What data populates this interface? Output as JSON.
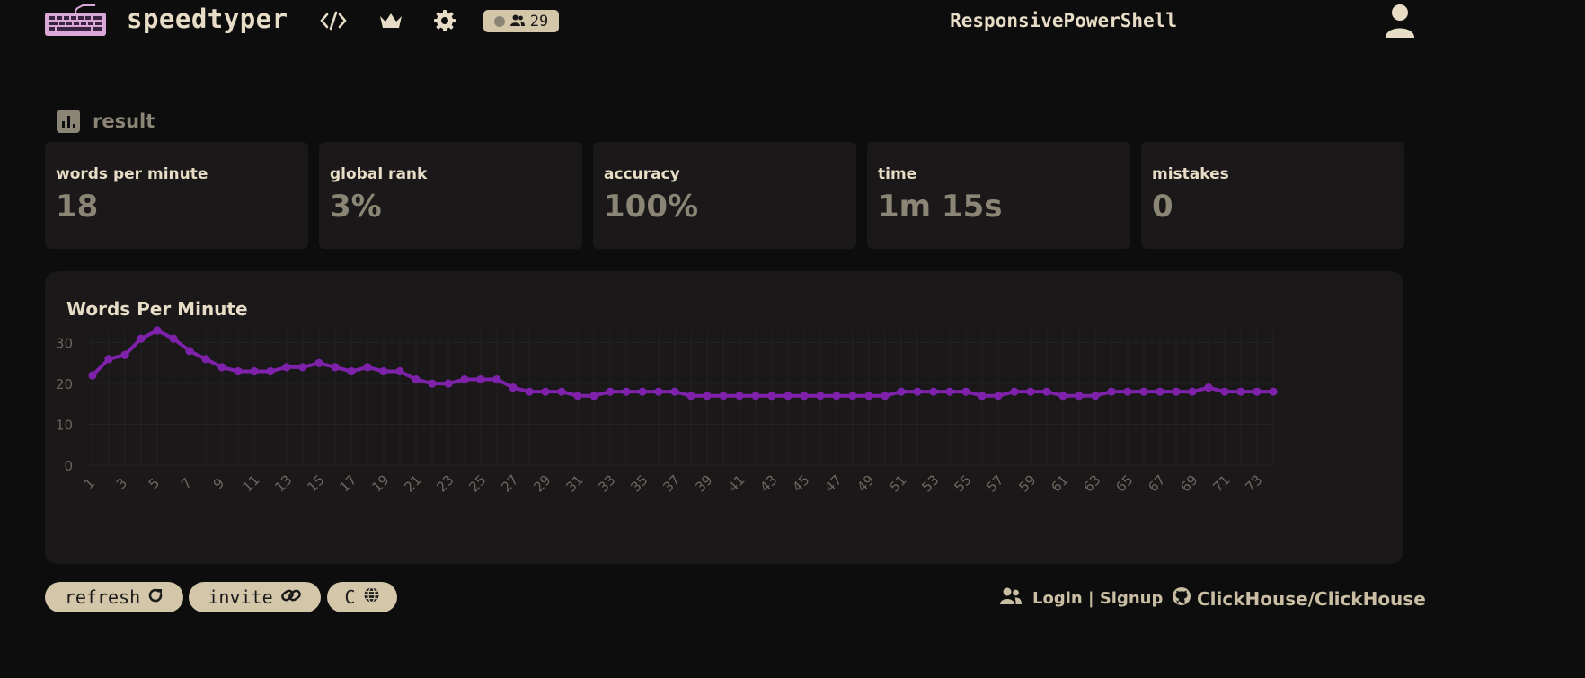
{
  "header": {
    "brand": "speedtyper",
    "online_count": "29",
    "username": "ResponsivePowerShell",
    "icons": [
      "keyboard-logo-icon",
      "code-icon",
      "crown-icon",
      "gear-icon",
      "users-icon",
      "user-icon"
    ]
  },
  "result": {
    "title": "result",
    "stats": [
      {
        "label": "words per minute",
        "value": "18"
      },
      {
        "label": "global rank",
        "value": "3%"
      },
      {
        "label": "accuracy",
        "value": "100%"
      },
      {
        "label": "time",
        "value": "1m 15s"
      },
      {
        "label": "mistakes",
        "value": "0"
      }
    ]
  },
  "chart_data": {
    "type": "line",
    "title": "Words Per Minute",
    "xlabel": "",
    "ylabel": "",
    "x": [
      1,
      2,
      3,
      4,
      5,
      6,
      7,
      8,
      9,
      10,
      11,
      12,
      13,
      14,
      15,
      16,
      17,
      18,
      19,
      20,
      21,
      22,
      23,
      24,
      25,
      26,
      27,
      28,
      29,
      30,
      31,
      32,
      33,
      34,
      35,
      36,
      37,
      38,
      39,
      40,
      41,
      42,
      43,
      44,
      45,
      46,
      47,
      48,
      49,
      50,
      51,
      52,
      53,
      54,
      55,
      56,
      57,
      58,
      59,
      60,
      61,
      62,
      63,
      64,
      65,
      66,
      67,
      68,
      69,
      70,
      71,
      72,
      73,
      74
    ],
    "x_tick_labels": [
      "1",
      "3",
      "5",
      "7",
      "9",
      "11",
      "13",
      "15",
      "17",
      "19",
      "21",
      "23",
      "25",
      "27",
      "29",
      "31",
      "33",
      "35",
      "37",
      "39",
      "41",
      "43",
      "45",
      "47",
      "49",
      "51",
      "53",
      "55",
      "57",
      "59",
      "61",
      "63",
      "65",
      "67",
      "69",
      "71",
      "73"
    ],
    "y_tick_labels": [
      "0",
      "10",
      "20",
      "30"
    ],
    "ylim": [
      0,
      33
    ],
    "grid": true,
    "series": [
      {
        "color": "#7e22ab",
        "values": [
          22,
          26,
          27,
          31,
          33,
          31,
          28,
          26,
          24,
          23,
          23,
          23,
          24,
          24,
          25,
          24,
          23,
          24,
          23,
          23,
          21,
          20,
          20,
          21,
          21,
          21,
          19,
          18,
          18,
          18,
          17,
          17,
          18,
          18,
          18,
          18,
          18,
          17,
          17,
          17,
          17,
          17,
          17,
          17,
          17,
          17,
          17,
          17,
          17,
          17,
          18,
          18,
          18,
          18,
          18,
          17,
          17,
          18,
          18,
          18,
          17,
          17,
          17,
          18,
          18,
          18,
          18,
          18,
          18,
          19,
          18,
          18,
          18,
          18
        ]
      }
    ]
  },
  "actions": {
    "refresh_label": "refresh",
    "invite_label": "invite",
    "language_label": "C"
  },
  "footer": {
    "login_label": "Login | Signup",
    "github_label": "ClickHouse/ClickHouse"
  }
}
